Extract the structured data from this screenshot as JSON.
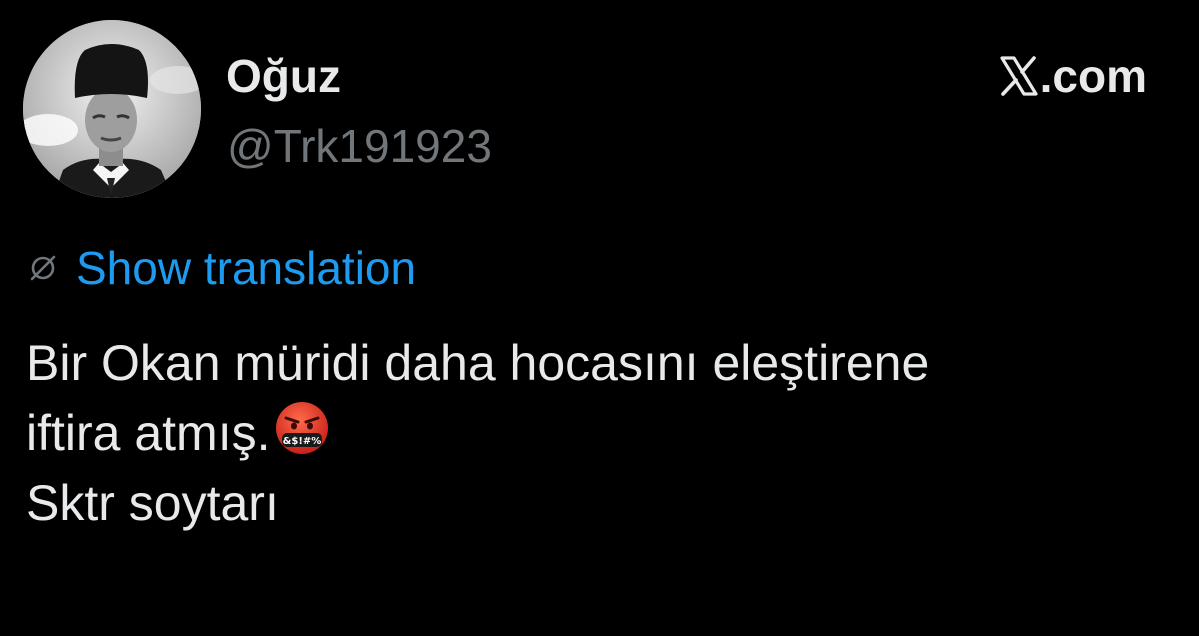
{
  "author": {
    "display_name": "Oğuz",
    "handle": "@Trk191923",
    "avatar_icon": "portrait-avatar"
  },
  "site": {
    "logo_icon": "x-logo-icon",
    "label": ".com"
  },
  "translation": {
    "icon": "globe-icon",
    "link_label": "Show translation"
  },
  "tweet": {
    "lines": [
      "Bir Okan müridi daha hocasını eleştirene",
      "iftira atmış.",
      "Sktr soytarı"
    ],
    "emoji": "face-with-symbols-on-mouth",
    "emoji_symbols": "&$!#%"
  },
  "colors": {
    "background": "#000000",
    "text_primary": "#e7e9ea",
    "text_secondary": "#71767b",
    "link": "#1d9bf0",
    "emoji_face": "#e5382c"
  }
}
